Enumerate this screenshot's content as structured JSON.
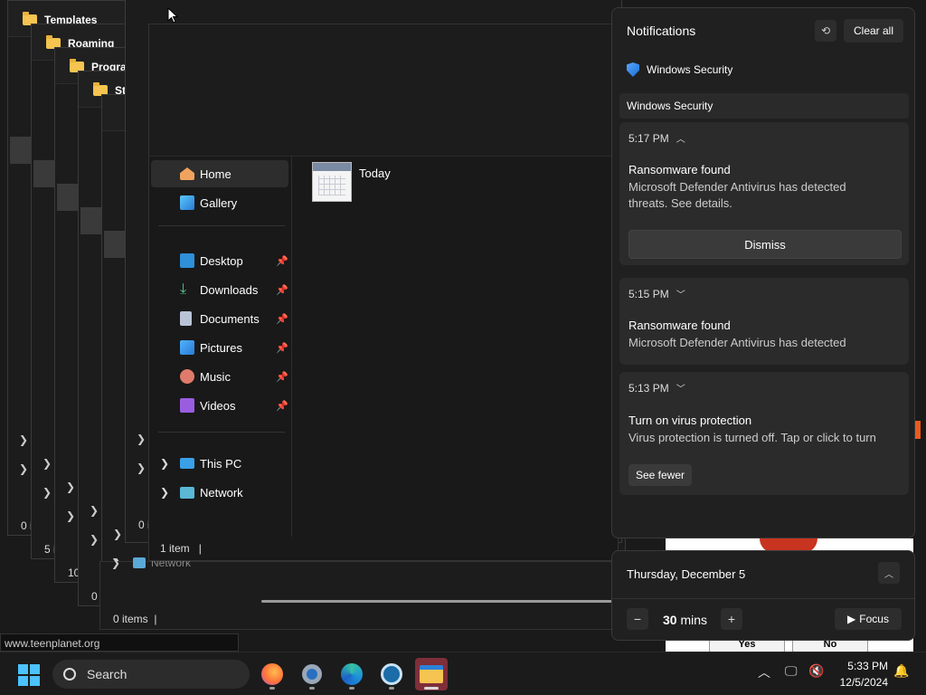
{
  "stacked_windows": [
    {
      "title": "Templates",
      "count": "0 i"
    },
    {
      "title": "Roaming",
      "count": "5 i"
    },
    {
      "title": "Progra",
      "count": "10"
    },
    {
      "title": "St",
      "count": "0 i"
    },
    {
      "title": "",
      "count": "0 i"
    }
  ],
  "explorer": {
    "nav": {
      "home": "Home",
      "gallery": "Gallery",
      "desktop": "Desktop",
      "downloads": "Downloads",
      "documents": "Documents",
      "pictures": "Pictures",
      "music": "Music",
      "videos": "Videos",
      "this_pc": "This PC",
      "network": "Network"
    },
    "file": {
      "name": "Today"
    },
    "status": "1 item",
    "behind_status": "0 items",
    "behind_network": "Network"
  },
  "notifications": {
    "title": "Notifications",
    "clear_all": "Clear all",
    "app_name": "Windows Security",
    "group_header": "Windows Security",
    "items": [
      {
        "time": "5:17 PM",
        "title": "Ransomware found",
        "body_line1": "Microsoft Defender Antivirus has detected",
        "body_line2": "threats. See details.",
        "dismiss": "Dismiss"
      },
      {
        "time": "5:15 PM",
        "title": "Ransomware found",
        "body_line1": "Microsoft Defender Antivirus has detected"
      },
      {
        "time": "5:13 PM",
        "title": "Turn on virus protection",
        "body_line1": "Virus protection is turned off. Tap or click to turn",
        "see_fewer": "See fewer"
      }
    ]
  },
  "calendar": {
    "date": "Thursday, December 5",
    "focus_minutes": "30",
    "mins_label": "mins",
    "focus_label": "Focus"
  },
  "dialog": {
    "yes": "Yes",
    "no": "No"
  },
  "url_tooltip": "www.teenplanet.org",
  "taskbar": {
    "search_placeholder": "Search",
    "time": "5:33 PM",
    "date": "12/5/2024"
  }
}
